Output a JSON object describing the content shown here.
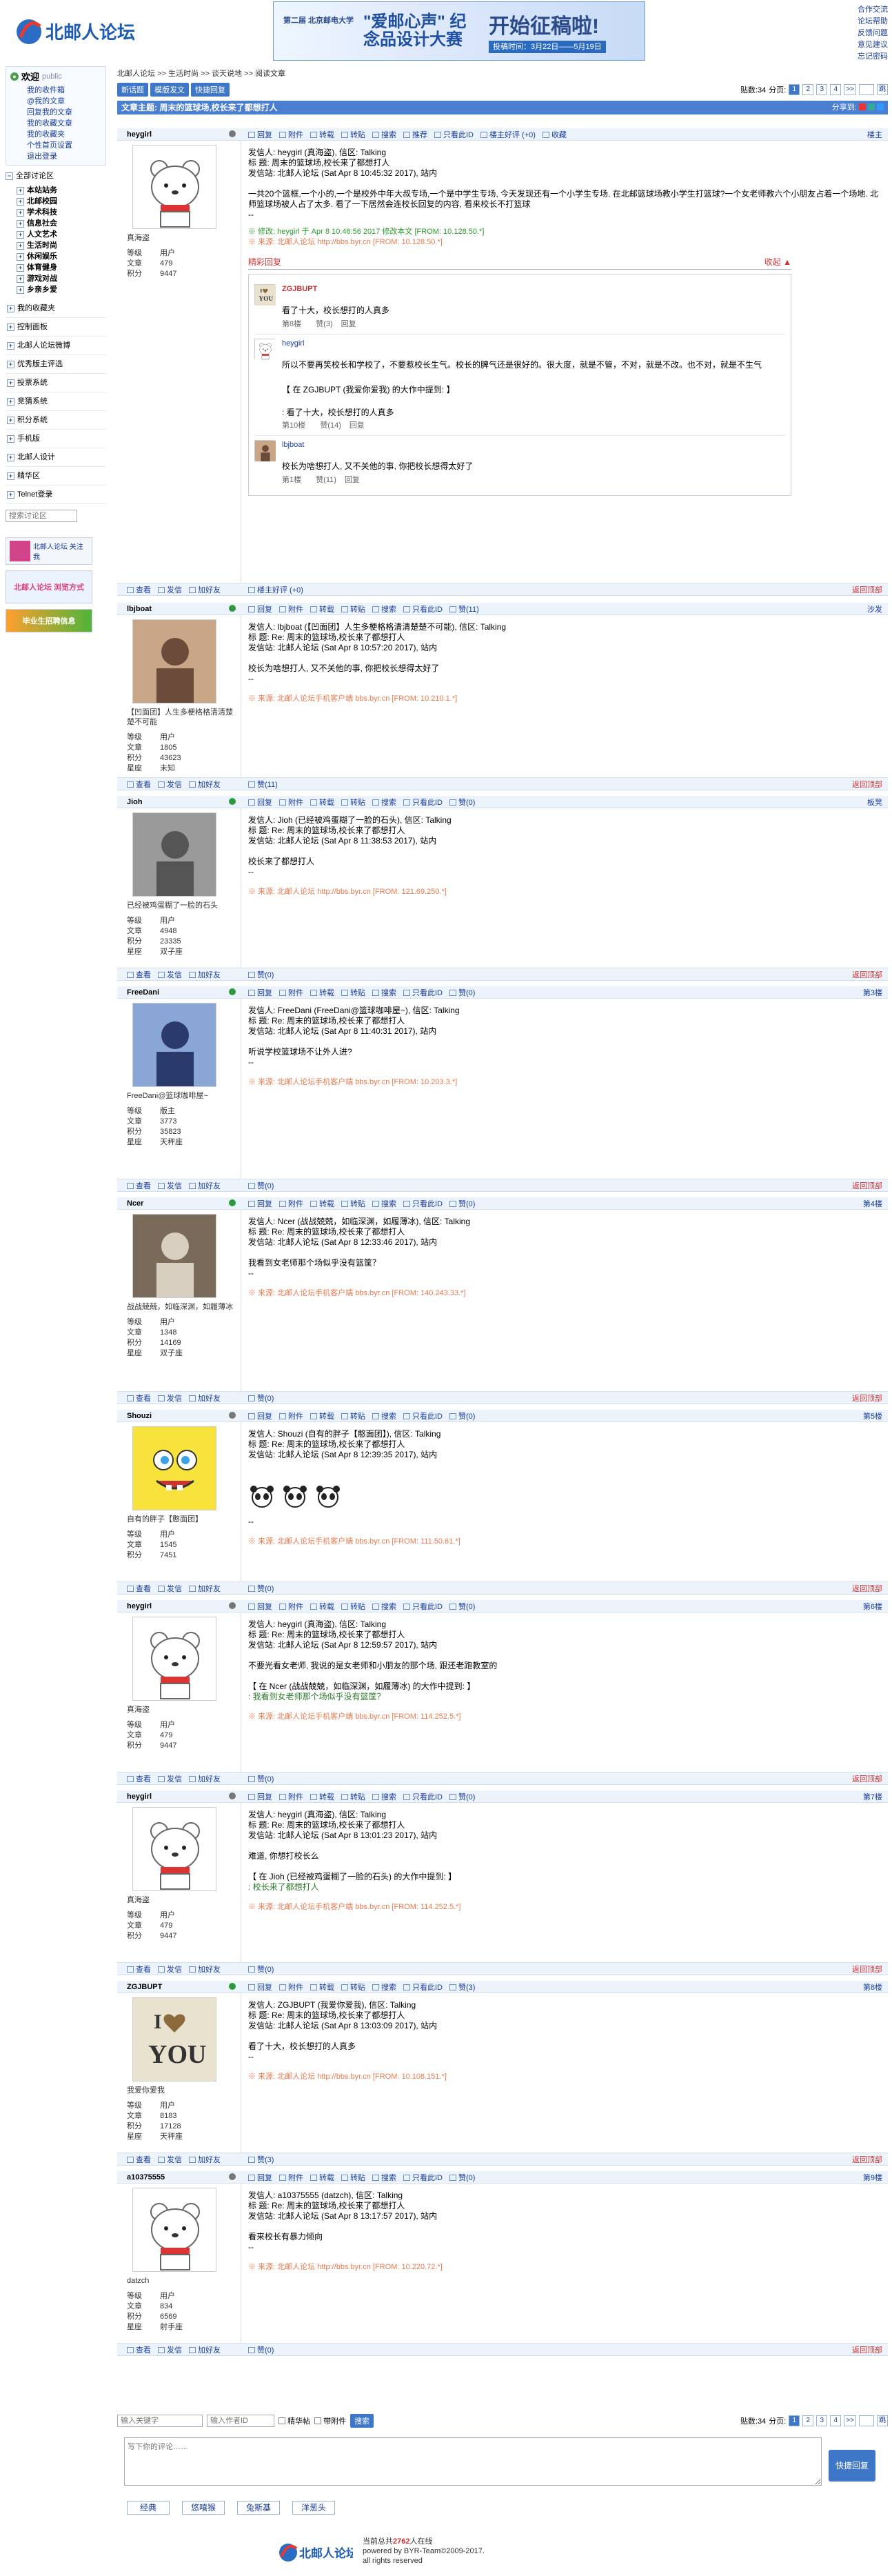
{
  "site": {
    "logo_text": "北邮人论坛",
    "banner": {
      "left": "第二届 北京邮电大学",
      "main": "\"爱邮心声\" 纪念品设计大赛",
      "right": "开始征稿啦!",
      "sub": "投稿时间：3月22日——5月19日"
    },
    "top_links": [
      "合作交流",
      "论坛帮助",
      "反馈问题",
      "意见建议",
      "忘记密码"
    ]
  },
  "sidebar": {
    "welcome": "欢迎",
    "user": "public",
    "user_links": [
      "我的收件箱",
      "@我的文章",
      "回复我的文章",
      "我的收藏文章",
      "我的收藏夹",
      "个性首页设置",
      "退出登录"
    ],
    "all_boards": "全部讨论区",
    "boards": [
      "本站站务",
      "北邮校园",
      "学术科技",
      "信息社会",
      "人文艺术",
      "生活时尚",
      "休闲娱乐",
      "体育健身",
      "游戏对战",
      "乡亲乡爱"
    ],
    "sections": [
      "我的收藏夹",
      "控制面板",
      "北邮人论坛微博",
      "优秀版主评选",
      "投票系统",
      "竞猜系统",
      "积分系统",
      "手机版",
      "北邮人设计",
      "精华区",
      "Telnet登录"
    ],
    "search_placeholder": "搜索讨论区",
    "promo1": "北邮人论坛 关注我",
    "promo2": "北邮人论坛 浏览方式",
    "promo3": "毕业生招聘信息"
  },
  "main": {
    "breadcrumb": [
      "北邮人论坛",
      ">>",
      "生活时尚",
      ">>",
      "谈天说地",
      ">>",
      "阅读文章"
    ],
    "buttons": [
      "新话题",
      "模版发文",
      "快捷回复"
    ],
    "article_count_label": "贴数:34",
    "page_label": "分页:",
    "pages": [
      "1",
      "2",
      "3",
      "4",
      ">>"
    ],
    "go_label": "跳",
    "title": "文章主题: 周末的篮球场,校长来了都想打人",
    "share_label": "分享到:"
  },
  "post_tools": {
    "reply": "回复",
    "attach": "附件",
    "forward": "转载",
    "cross": "转贴",
    "search": "搜索",
    "recommend": "推荐",
    "only_author": "只看此ID",
    "author_reply": "楼主好评 (+0)",
    "collect": "收藏",
    "like": "赞"
  },
  "foot_tools": {
    "view": "查看",
    "mail": "发信",
    "friend": "加好友",
    "back_top": "返回顶部"
  },
  "stat_labels": {
    "level": "等级",
    "articles": "文章",
    "score": "积分",
    "star": "星座"
  },
  "posts": [
    {
      "name": "heygirl",
      "floor": "楼主",
      "status": "offline",
      "nick": "真海盗",
      "stats": {
        "level": "用户",
        "articles": "479",
        "score": "9447"
      },
      "lines": [
        "发信人: heygirl (真海盗), 信区: Talking",
        "标  题: 周末的篮球场,校长来了都想打人",
        "发信站: 北邮人论坛 (Sat Apr  8 10:45:32 2017), 站内",
        "",
        "一共20个篮框,一个小的,一个是校外中年大叔专场,一个是中学生专场, 今天发现还有一个小学生专场. 在北邮篮球场教小学生打篮球?一个女老师教六个小朋友占着一个场地. 北师篮球场被人占了太多. 看了一下居然会连校长回复的内容, 看来校长不打篮球",
        "--"
      ],
      "edited": "※ 修改: heygirl 于 Apr  8 10:46:56 2017 修改本文 [FROM: 10.128.50.*]",
      "source": "※ 来源: 北邮人论坛 http://bbs.byr.cn [FROM: 10.128.50.*]",
      "likes": "楼主好评 (+0)"
    },
    {
      "name": "lbjboat",
      "floor": "沙发",
      "status": "online",
      "nick": "【凹面团】人生多梗格格清清楚楚不可能",
      "stats": {
        "level": "用户",
        "articles": "1805",
        "score": "43623",
        "star": "未知"
      },
      "lines": [
        "发信人: lbjboat (【凹面团】人生多梗格格清清楚楚不可能), 信区: Talking",
        "标  题: Re: 周末的篮球场,校长来了都想打人",
        "发信站: 北邮人论坛 (Sat Apr  8 10:57:20 2017), 站内",
        "",
        "校长为啥想打人, 又不关他的事, 你把校长想得太好了",
        "--"
      ],
      "source": "※ 来源: 北邮人论坛手机客户端 bbs.byr.cn [FROM: 10.210.1.*]",
      "likes": "赞(11)"
    },
    {
      "name": "Jioh",
      "floor": "板凳",
      "status": "online",
      "nick": "已经被鸡蛋糊了一脸的石头",
      "stats": {
        "level": "用户",
        "articles": "4948",
        "score": "23335",
        "star": "双子座"
      },
      "lines": [
        "发信人: Jioh (已经被鸡蛋糊了一脸的石头), 信区: Talking",
        "标  题: Re: 周末的篮球场,校长来了都想打人",
        "发信站: 北邮人论坛 (Sat Apr  8 11:38:53 2017), 站内",
        "",
        "校长来了都想打人",
        "--"
      ],
      "source": "※ 来源: 北邮人论坛 http://bbs.byr.cn [FROM: 121.69.250.*]",
      "likes": "赞(0)"
    },
    {
      "name": "FreeDani",
      "floor": "第3楼",
      "status": "online",
      "nick": "FreeDani@篮球咖啡屋~",
      "stats": {
        "level": "版主",
        "articles": "3773",
        "score": "35823",
        "star": "天秤座"
      },
      "lines": [
        "发信人: FreeDani (FreeDani@篮球咖啡屋~), 信区: Talking",
        "标  题: Re: 周末的篮球场,校长来了都想打人",
        "发信站: 北邮人论坛 (Sat Apr  8 11:40:31 2017), 站内",
        "",
        "听说学校篮球场不让外人进?",
        "--"
      ],
      "source": "※ 来源: 北邮人论坛手机客户端 bbs.byr.cn [FROM: 10.203.3.*]",
      "likes": "赞(0)"
    },
    {
      "name": "Ncer",
      "floor": "第4楼",
      "status": "online",
      "nick": "战战兢兢，如临深渊，如履薄冰",
      "stats": {
        "level": "用户",
        "articles": "1348",
        "score": "14169",
        "star": "双子座"
      },
      "lines": [
        "发信人: Ncer (战战兢兢，如临深渊，如履薄冰), 信区: Talking",
        "标  题: Re: 周末的篮球场,校长来了都想打人",
        "发信站: 北邮人论坛 (Sat Apr  8 12:33:46 2017), 站内",
        "",
        "我看到女老师那个场似乎没有篮筐？",
        "--"
      ],
      "source": "※ 来源: 北邮人论坛手机客户端 bbs.byr.cn [FROM: 140.243.33.*]",
      "likes": "赞(0)"
    },
    {
      "name": "Shouzi",
      "floor": "第5楼",
      "status": "offline",
      "nick": "自有的胖子【憨面团】",
      "stats": {
        "level": "用户",
        "articles": "1545",
        "score": "7451"
      },
      "lines": [
        "发信人: Shouzi (自有的胖子【憨面团】), 信区: Talking",
        "标  题: Re: 周末的篮球场,校长来了都想打人",
        "发信站: 北邮人论坛 (Sat Apr  8 12:39:35 2017), 站内",
        "",
        "",
        "--"
      ],
      "source": "※ 来源: 北邮人论坛手机客户端 bbs.byr.cn [FROM: 111.50.61.*]",
      "likes": "赞(0)"
    },
    {
      "name": "heygirl",
      "floor": "第6楼",
      "status": "offline",
      "nick": "真海盗",
      "stats": {
        "level": "用户",
        "articles": "479",
        "score": "9447"
      },
      "lines": [
        "发信人: heygirl (真海盗), 信区: Talking",
        "标  题: Re: 周末的篮球场,校长来了都想打人",
        "发信站: 北邮人论坛 (Sat Apr  8 12:59:57 2017), 站内",
        "",
        "不要光看女老师, 我说的是女老师和小朋友的那个场, 跟还老跑教室的",
        "",
        "【 在 Ncer (战战兢兢，如临深渊，如履薄冰) 的大作中提到: 】"
      ],
      "quote": ": 我看到女老师那个场似乎没有篮筐？",
      "source": "※ 来源: 北邮人论坛手机客户端 bbs.byr.cn [FROM: 114.252.5.*]",
      "likes": "赞(0)"
    },
    {
      "name": "heygirl",
      "floor": "第7楼",
      "status": "offline",
      "nick": "真海盗",
      "stats": {
        "level": "用户",
        "articles": "479",
        "score": "9447"
      },
      "lines": [
        "发信人: heygirl (真海盗), 信区: Talking",
        "标  题: Re: 周末的篮球场,校长来了都想打人",
        "发信站: 北邮人论坛 (Sat Apr  8 13:01:23 2017), 站内",
        "",
        "难道, 你想打校长么",
        "",
        "【 在 Jioh (已经被鸡蛋糊了一脸的石头) 的大作中提到: 】"
      ],
      "quote": ": 校长来了都想打人",
      "source": "※ 来源: 北邮人论坛手机客户端 bbs.byr.cn [FROM: 114.252.5.*]",
      "likes": "赞(0)"
    },
    {
      "name": "ZGJBUPT",
      "floor": "第8楼",
      "status": "online",
      "nick": "我爱你爱我",
      "stats": {
        "level": "用户",
        "articles": "8183",
        "score": "17128",
        "star": "天秤座"
      },
      "lines": [
        "发信人: ZGJBUPT (我爱你爱我), 信区: Talking",
        "标  题: Re: 周末的篮球场,校长来了都想打人",
        "发信站: 北邮人论坛 (Sat Apr  8 13:03:09 2017), 站内",
        "",
        "看了十大，校长想打的人真多",
        "--"
      ],
      "source": "※ 来源: 北邮人论坛 http://bbs.byr.cn [FROM: 10.108.151.*]",
      "likes": "赞(3)"
    },
    {
      "name": "a10375555",
      "floor": "第9楼",
      "status": "offline",
      "nick": "datzch",
      "stats": {
        "level": "用户",
        "articles": "834",
        "score": "6569",
        "star": "射手座"
      },
      "lines": [
        "发信人: a10375555 (datzch), 信区: Talking",
        "标  题: Re: 周末的篮球场,校长来了都想打人",
        "发信站: 北邮人论坛 (Sat Apr  8 13:17:57 2017), 站内",
        "",
        "看来校长有暴力倾向",
        "--"
      ],
      "source": "※ 来源: 北邮人论坛 http://bbs.byr.cn [FROM: 10.220.72.*]",
      "likes": "赞(0)"
    }
  ],
  "best_replies": {
    "title": "精彩回复",
    "collapse": "收起 ▲",
    "items": [
      {
        "name": "ZGJBUPT",
        "text": "看了十大，校长想打的人真多",
        "meta": "第8楼",
        "likes": "赞(3)",
        "reply": "回复"
      },
      {
        "name": "heygirl",
        "text": "所以不要再笑校长和学校了，不要惹校长生气。校长的脾气还是很好的。很大度，就是不管，不对，就是不改。也不对，就是不生气",
        "quote": "【 在 ZGJBUPT (我爱你爱我) 的大作中提到: 】",
        "quote2": ": 看了十大，校长想打的人真多",
        "meta": "第10楼",
        "likes": "赞(14)",
        "reply": "回复"
      },
      {
        "name": "lbjboat",
        "text": "校长为啥想打人, 又不关他的事, 你把校长想得太好了",
        "meta": "第1楼",
        "likes": "赞(11)",
        "reply": "回复"
      }
    ]
  },
  "bottom": {
    "keyword_placeholder": "输入关键字",
    "author_placeholder": "输入作者ID",
    "only_best": "精华帖",
    "only_attach": "带附件",
    "search_btn": "搜索",
    "reply_placeholder": "写下你的评论……",
    "reply_btn": "快捷回复",
    "emoji_tabs": [
      "经典",
      "悠嘻猴",
      "兔斯基",
      "洋葱头"
    ]
  },
  "footer": {
    "online_label": "当前总共",
    "online_count": "2762",
    "online_suffix": "人在线",
    "powered": "powered by BYR-Team©2009-2017.",
    "rights": "all rights reserved"
  },
  "colors": {
    "accent": "#3e76c8",
    "title_bar": "#4a7ed0",
    "row_bg": "#edf3fb",
    "best_title": "#cc3333",
    "source": "#e87a4e"
  }
}
